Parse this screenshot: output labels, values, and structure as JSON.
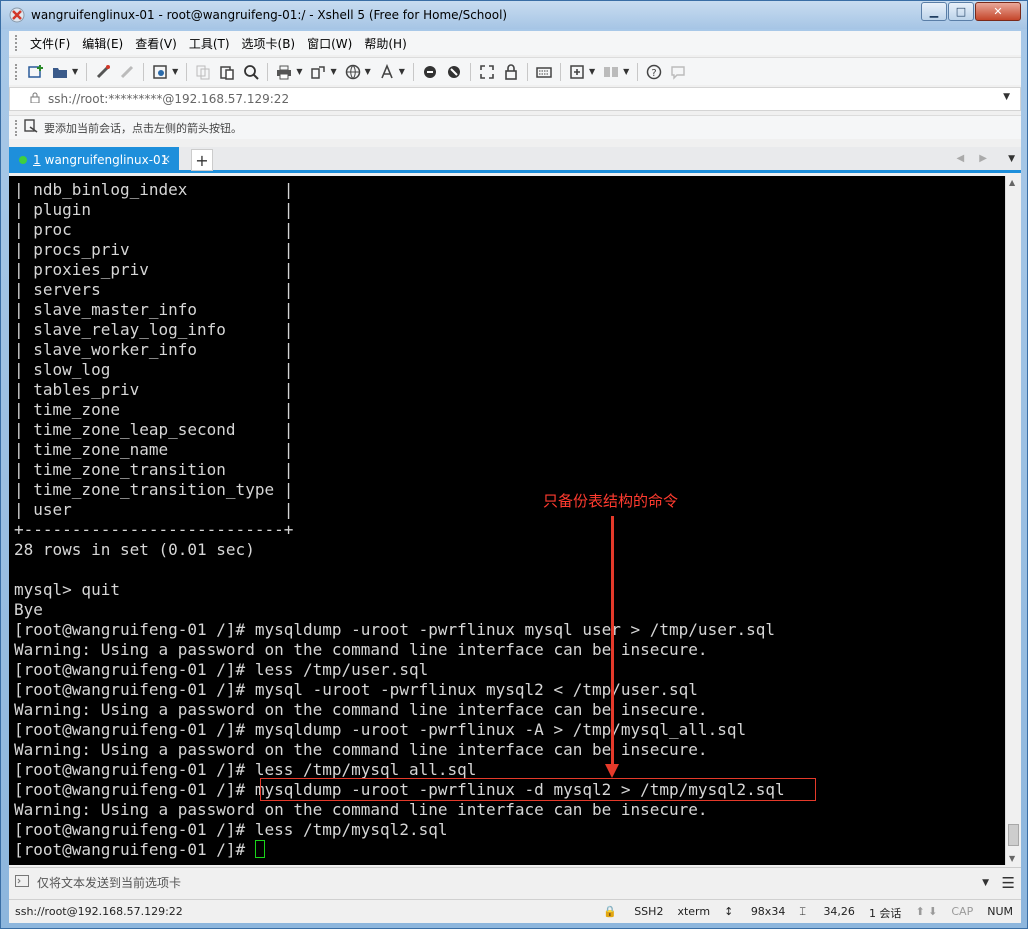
{
  "window": {
    "title": "wangruifenglinux-01 - root@wangruifeng-01:/ - Xshell 5 (Free for Home/School)",
    "controls": {
      "minimize": "▁",
      "maximize": "□",
      "close": "✕"
    }
  },
  "menu": {
    "items": [
      "文件(F)",
      "编辑(E)",
      "查看(V)",
      "工具(T)",
      "选项卡(B)",
      "窗口(W)",
      "帮助(H)"
    ]
  },
  "toolbar": {
    "icons": [
      "new-session-icon",
      "open-folder-icon",
      "connect-icon",
      "disconnect-icon",
      "properties-icon",
      "copy-icon",
      "paste-icon",
      "find-icon",
      "print-icon",
      "transfer-icon",
      "globe-icon",
      "font-icon",
      "xftp-icon",
      "xagent-icon",
      "fullscreen-icon",
      "lock-icon",
      "keyboard-icon",
      "new-tab-icon",
      "layout-icon",
      "help-icon",
      "chat-icon"
    ]
  },
  "address": {
    "value": "ssh://root:*********@192.168.57.129:22"
  },
  "linkbar": {
    "text": "要添加当前会话，点击左侧的箭头按钮。"
  },
  "tabs": [
    {
      "number": "1",
      "label": "wangruifenglinux-01",
      "close": "×",
      "status_color": "#3fcf3f"
    }
  ],
  "tab_add": "+",
  "terminal": {
    "lines": [
      "| ndb_binlog_index          |",
      "| plugin                    |",
      "| proc                      |",
      "| procs_priv                |",
      "| proxies_priv              |",
      "| servers                   |",
      "| slave_master_info         |",
      "| slave_relay_log_info      |",
      "| slave_worker_info         |",
      "| slow_log                  |",
      "| tables_priv               |",
      "| time_zone                 |",
      "| time_zone_leap_second     |",
      "| time_zone_name            |",
      "| time_zone_transition      |",
      "| time_zone_transition_type |",
      "| user                      |",
      "+---------------------------+",
      "28 rows in set (0.01 sec)",
      "",
      "mysql> quit",
      "Bye",
      "[root@wangruifeng-01 /]# mysqldump -uroot -pwrflinux mysql user > /tmp/user.sql",
      "Warning: Using a password on the command line interface can be insecure.",
      "[root@wangruifeng-01 /]# less /tmp/user.sql",
      "[root@wangruifeng-01 /]# mysql -uroot -pwrflinux mysql2 < /tmp/user.sql",
      "Warning: Using a password on the command line interface can be insecure.",
      "[root@wangruifeng-01 /]# mysqldump -uroot -pwrflinux -A > /tmp/mysql_all.sql",
      "Warning: Using a password on the command line interface can be insecure.",
      "[root@wangruifeng-01 /]# less /tmp/mysql_all.sql",
      "[root@wangruifeng-01 /]# mysqldump -uroot -pwrflinux -d mysql2 > /tmp/mysql2.sql",
      "Warning: Using a password on the command line interface can be insecure.",
      "[root@wangruifeng-01 /]# less /tmp/mysql2.sql",
      "[root@wangruifeng-01 /]# "
    ],
    "annotation": "只备份表结构的命令",
    "annotation_color": "#e53a2a"
  },
  "compose": {
    "text": "仅将文本发送到当前选项卡"
  },
  "status": {
    "connection": "ssh://root@192.168.57.129:22",
    "protocol": "SSH2",
    "term": "xterm",
    "size": "98x34",
    "cursor_pos": "34,26",
    "sessions": "1 会话",
    "cap": "CAP",
    "num": "NUM"
  }
}
